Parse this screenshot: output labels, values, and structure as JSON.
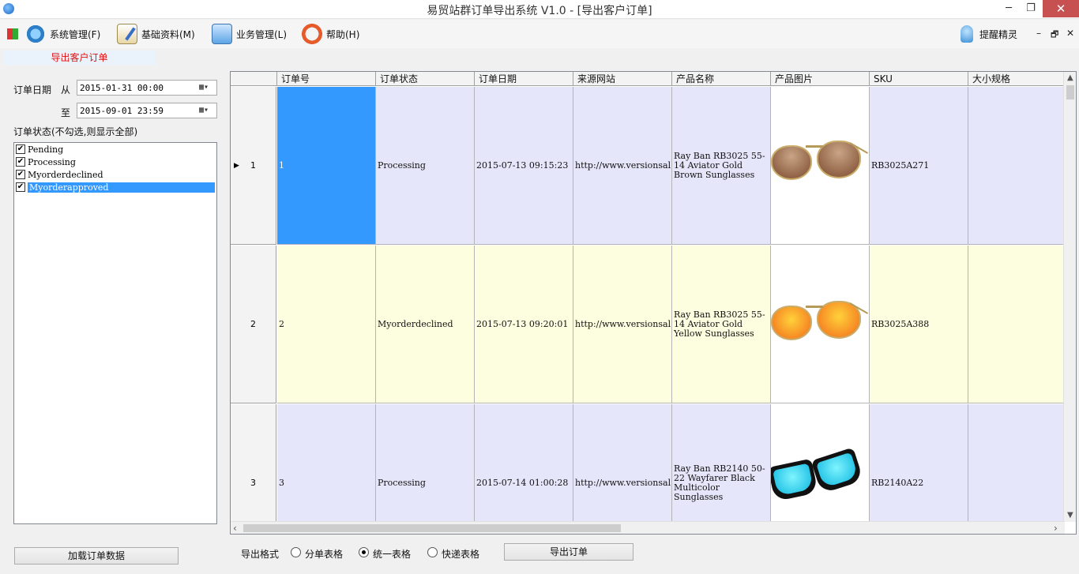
{
  "window": {
    "title": "易贸站群订单导出系统 V1.0 - [导出客户订单]",
    "min_glyph": "─",
    "max_glyph": "❐",
    "close_glyph": "✕"
  },
  "menu": {
    "items": [
      {
        "label": "系统管理(F)",
        "icon": "gear-ship-icon"
      },
      {
        "label": "基础资料(M)",
        "icon": "notepad-icon"
      },
      {
        "label": "业务管理(L)",
        "icon": "monitor-icon"
      },
      {
        "label": "帮助(H)",
        "icon": "lifebuoy-icon"
      }
    ],
    "assistant_label": "提醒精灵",
    "mdi_min": "–",
    "mdi_restore": "🗗",
    "mdi_close": "✕"
  },
  "tabs": [
    {
      "label": "导出客户订单",
      "active": true
    }
  ],
  "filter": {
    "date_label": "订单日期",
    "from_label": "从",
    "to_label": "至",
    "from_value": "2015-01-31 00:00",
    "to_value": "2015-09-01 23:59",
    "calendar_glyph": "▦▾",
    "status_label": "订单状态(不勾选,则显示全部)",
    "statuses": [
      {
        "label": "Pending",
        "checked": true
      },
      {
        "label": "Processing",
        "checked": true
      },
      {
        "label": "Myorderdeclined",
        "checked": true
      },
      {
        "label": "Myorderapproved",
        "checked": true,
        "selected": true
      }
    ],
    "check_glyph": "✔",
    "load_button": "加载订单数据"
  },
  "grid": {
    "columns": [
      "订单号",
      "订单状态",
      "订单日期",
      "来源网站",
      "产品名称",
      "产品图片",
      "SKU",
      "大小规格"
    ],
    "rows": [
      {
        "row_no": "1",
        "current": true,
        "order_no": "1",
        "status": "Processing",
        "date": "2015-07-13 09:15:23",
        "site": "http://www.versionsal",
        "product": "Ray Ban RB3025 55-14 Aviator Gold Brown Sunglasses",
        "image": "aviator-gold-brown-sunglasses",
        "sku": "RB3025A271",
        "size": ""
      },
      {
        "row_no": "2",
        "order_no": "2",
        "status": "Myorderdeclined",
        "date": "2015-07-13 09:20:01",
        "site": "http://www.versionsal",
        "product": "Ray Ban RB3025 55-14 Aviator Gold Yellow Sunglasses",
        "image": "aviator-gold-yellow-sunglasses",
        "sku": "RB3025A388",
        "size": ""
      },
      {
        "row_no": "3",
        "order_no": "3",
        "status": "Processing",
        "date": "2015-07-14 01:00:28",
        "site": "http://www.versionsal",
        "product": "Ray Ban RB2140 50-22 Wayfarer Black Multicolor Sunglasses",
        "image": "wayfarer-black-multicolor-sunglasses",
        "sku": "RB2140A22",
        "size": ""
      }
    ],
    "current_row_glyph": "▶"
  },
  "export": {
    "format_label": "导出格式",
    "options": [
      {
        "label": "分单表格",
        "selected": false
      },
      {
        "label": "统一表格",
        "selected": true
      },
      {
        "label": "快递表格",
        "selected": false
      }
    ],
    "export_button": "导出订单"
  },
  "colors": {
    "row_odd": "#e6e6fa",
    "row_even": "#fdfde0",
    "selection": "#3399ff",
    "tab_text": "#e01010"
  }
}
